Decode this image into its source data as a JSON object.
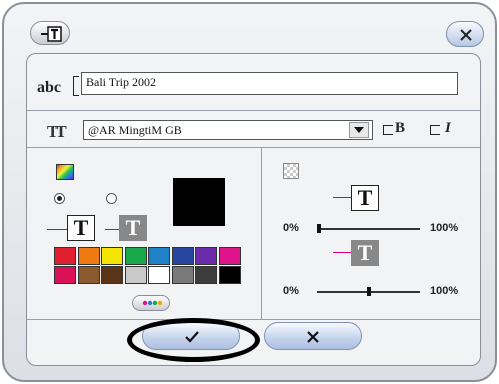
{
  "dialog": {
    "text_label": "abc",
    "text_value": "Bali Trip 2002",
    "font_value": "@AR MingtiM GB",
    "bold_label": "B",
    "italic_label": "I"
  },
  "color": {
    "current": "#000000",
    "palette": [
      "#e0202e",
      "#ef7a12",
      "#f4e600",
      "#18a84a",
      "#1f82c8",
      "#2746a0",
      "#6a2ca8",
      "#e0148a",
      "#d81255",
      "#8a5a2e",
      "#5a3418",
      "#c9c9c9",
      "#ffffff",
      "#7a7a7a",
      "#3c3c3c",
      "#000000"
    ]
  },
  "opacity": {
    "fill_min": "0%",
    "fill_max": "100%",
    "fill_level": 0,
    "shadow_min": "0%",
    "shadow_max": "100%",
    "shadow_level": 0.5
  },
  "buttons": {
    "ok": "check-icon",
    "cancel": "x-icon"
  }
}
